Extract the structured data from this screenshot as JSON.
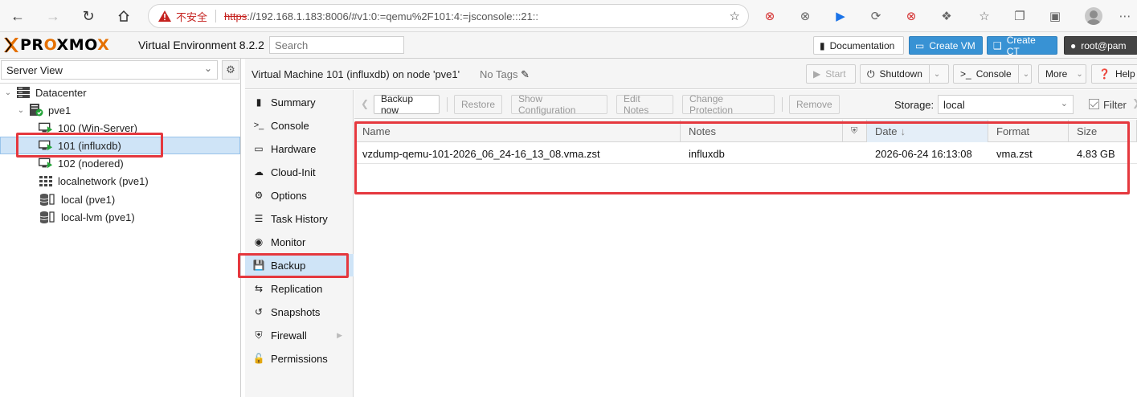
{
  "browser": {
    "insecure_label": "不安全",
    "url_protocol": "https",
    "url_rest": "://192.168.1.183:8006/#v1:0:=qemu%2F101:4:=jsconsole:::21::"
  },
  "header": {
    "logo_part1": "PR",
    "logo_part2": "O",
    "logo_part3": "XMO",
    "logo_part4": "X",
    "version": "Virtual Environment 8.2.2",
    "search_placeholder": "Search",
    "documentation_label": "Documentation",
    "create_vm_label": "Create VM",
    "create_ct_label": "Create CT",
    "user_label": "root@pam"
  },
  "tree": {
    "view": "Server View",
    "nodes": [
      {
        "label": "Datacenter"
      },
      {
        "label": "pve1"
      },
      {
        "label": "100 (Win-Server)"
      },
      {
        "label": "101 (influxdb)"
      },
      {
        "label": "102 (nodered)"
      },
      {
        "label": "localnetwork (pve1)"
      },
      {
        "label": "local (pve1)"
      },
      {
        "label": "local-lvm (pve1)"
      }
    ]
  },
  "vm": {
    "title": "Virtual Machine 101 (influxdb) on node 'pve1'",
    "tags": "No Tags",
    "start_label": "Start",
    "shutdown_label": "Shutdown",
    "console_label": "Console",
    "more_label": "More",
    "help_label": "Help"
  },
  "nav": {
    "items": [
      {
        "label": "Summary"
      },
      {
        "label": "Console"
      },
      {
        "label": "Hardware"
      },
      {
        "label": "Cloud-Init"
      },
      {
        "label": "Options"
      },
      {
        "label": "Task History"
      },
      {
        "label": "Monitor"
      },
      {
        "label": "Backup"
      },
      {
        "label": "Replication"
      },
      {
        "label": "Snapshots"
      },
      {
        "label": "Firewall"
      },
      {
        "label": "Permissions"
      }
    ]
  },
  "backup": {
    "backup_now_label": "Backup now",
    "restore_label": "Restore",
    "show_config_label": "Show Configuration",
    "edit_notes_label": "Edit Notes",
    "change_protection_label": "Change Protection",
    "remove_label": "Remove",
    "storage_label": "Storage:",
    "storage_value": "local",
    "filter_label": "Filter",
    "columns": {
      "name": "Name",
      "notes": "Notes",
      "date": "Date",
      "format": "Format",
      "size": "Size"
    },
    "rows": [
      {
        "name": "vzdump-qemu-101-2026_06_24-16_13_08.vma.zst",
        "notes": "influxdb",
        "date": "2026-06-24 16:13:08",
        "format": "vma.zst",
        "size": "4.83 GB"
      }
    ]
  },
  "colors": {
    "accent_blue": "#3892d4",
    "selection": "#cfe4f7",
    "highlight_red": "#e5383e",
    "logo_orange": "#e57000",
    "run_green": "#21a336"
  }
}
